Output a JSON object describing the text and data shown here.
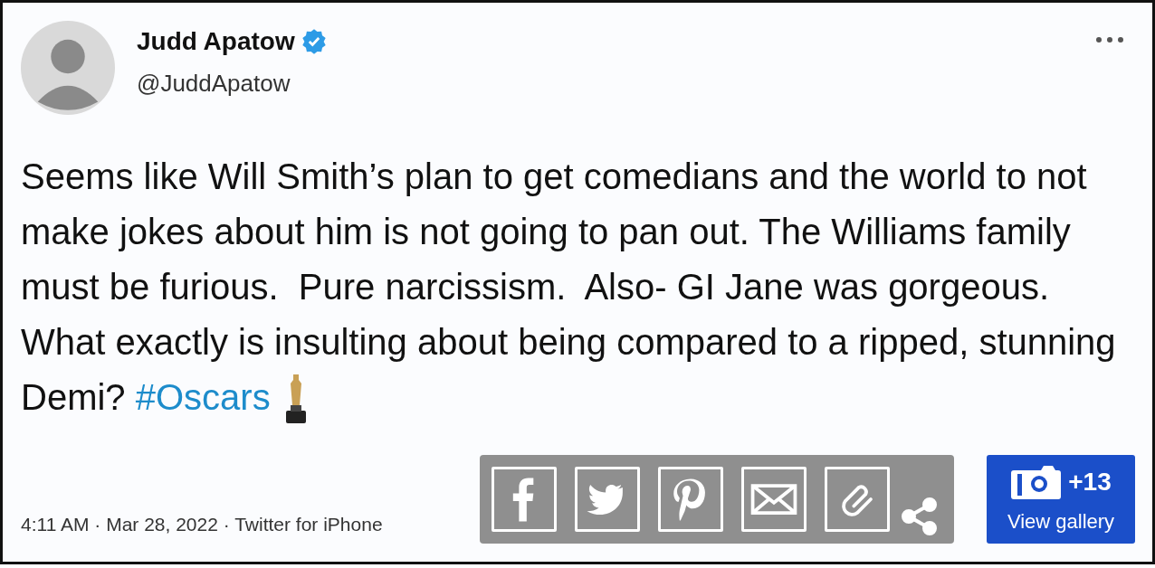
{
  "tweet": {
    "author": {
      "name": "Judd Apatow",
      "handle": "@JuddApatow",
      "verified": true
    },
    "text_parts": [
      {
        "kind": "text",
        "text": "Seems like Will Smith’s plan to get comedians and the world to not make jokes about him is not going to pan out. The Williams family must be furious.  Pure narcissism.  Also- GI Jane was gorgeous. What exactly is insulting about being compared to a ripped, stunning Demi? "
      },
      {
        "kind": "hashtag",
        "text": "#Oscars"
      },
      {
        "kind": "trophy"
      }
    ],
    "meta": "4:11 AM · Mar 28, 2022 · Twitter for iPhone"
  },
  "share_buttons": [
    {
      "kind": "facebook"
    },
    {
      "kind": "bird"
    },
    {
      "kind": "pin"
    },
    {
      "kind": "mail"
    },
    {
      "kind": "link"
    },
    {
      "kind": "share"
    }
  ],
  "gallery": {
    "count": "+13",
    "label": "View gallery"
  }
}
